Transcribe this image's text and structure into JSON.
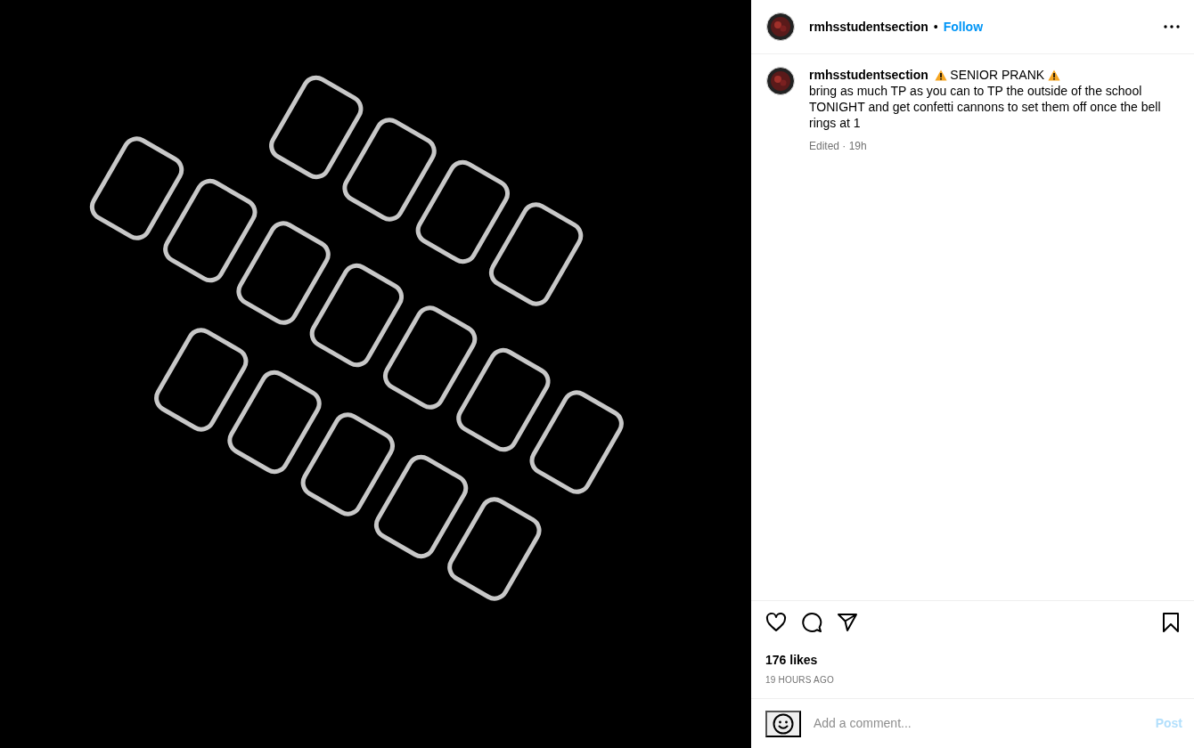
{
  "post": {
    "header": {
      "username": "rmhsstudentsection",
      "separator": "•",
      "follow": "Follow"
    },
    "caption": {
      "username": "rmhsstudentsection",
      "headline": "SENIOR PRANK",
      "body": "bring as much TP as you can to TP the outside of the school TONIGHT and get confetti cannons to set them off once the bell rings at 1",
      "meta": "Edited · 19h"
    },
    "likes": "176 likes",
    "timestamp": "19 HOURS AGO",
    "comment": {
      "placeholder": "Add a comment...",
      "post_button": "Post",
      "disabled": true
    }
  }
}
